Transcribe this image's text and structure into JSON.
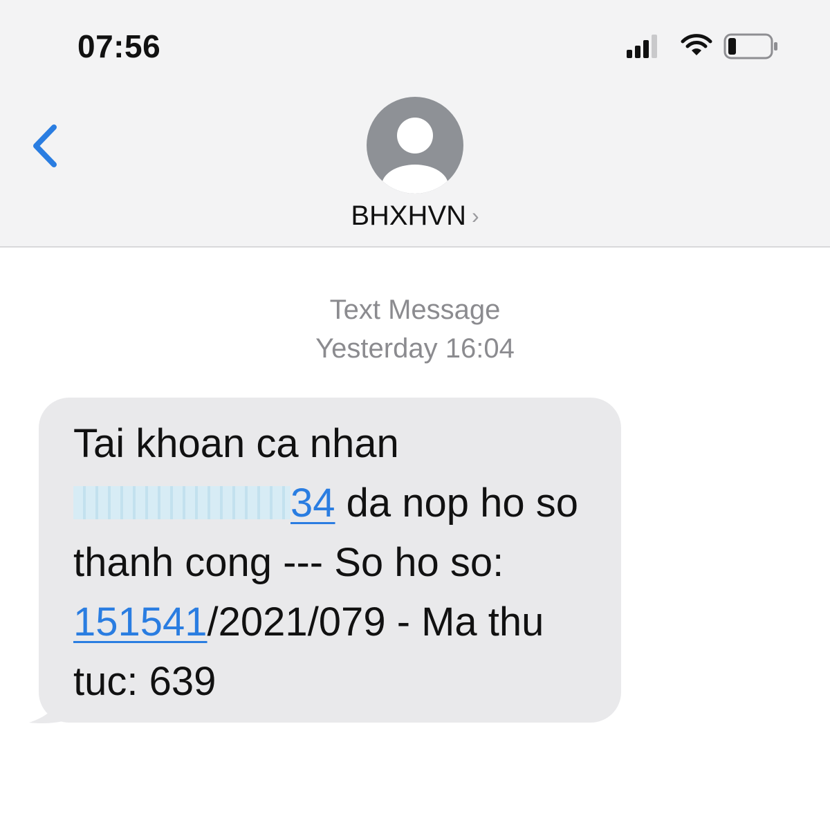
{
  "status_bar": {
    "time": "07:56",
    "icons": [
      "signal-icon",
      "wifi-icon",
      "battery-icon"
    ]
  },
  "header": {
    "back_icon": "chevron-left-icon",
    "avatar_icon": "person-icon",
    "contact_name": "BHXHVN",
    "contact_chevron": "›"
  },
  "conversation": {
    "meta_type": "Text Message",
    "meta_time": "Yesterday 16:04"
  },
  "message": {
    "line1": "Tai khoan ca nhan",
    "account_suffix": "34",
    "after_account": " da nop ho so",
    "line3": "thanh cong --- So ho so:",
    "record_link": "151541",
    "record_rest": "/2021/079 - Ma thu",
    "line5": "tuc: 639"
  },
  "colors": {
    "link": "#2a7de1",
    "bubble": "#e9e9eb",
    "header_bg": "#f3f3f4",
    "meta_text": "#8b8b8f"
  }
}
